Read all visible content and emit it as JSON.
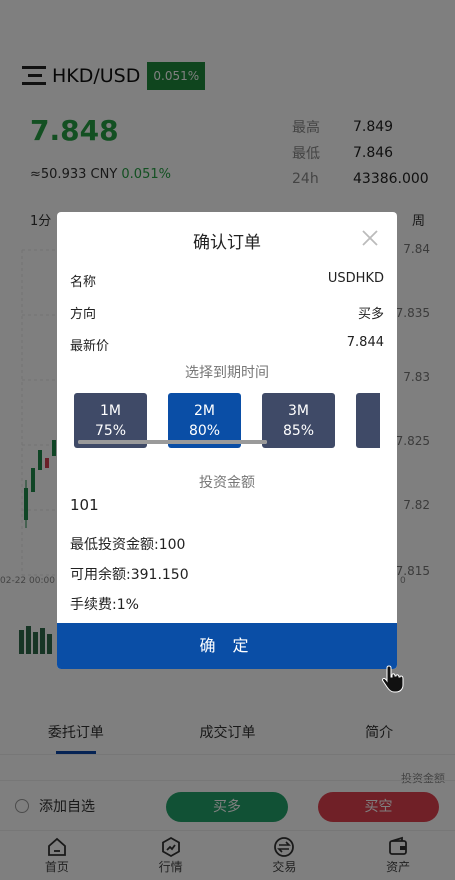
{
  "header": {
    "symbol": "HKD/USD",
    "change_badge": "0.051%"
  },
  "price": "7.848",
  "cny": {
    "value": "≈50.933 CNY",
    "change": "0.051%"
  },
  "stats": [
    {
      "label": "最高",
      "value": "7.849"
    },
    {
      "label": "最低",
      "value": "7.846"
    },
    {
      "label": "24h",
      "value": "43386.000"
    }
  ],
  "periods": {
    "first": "1分",
    "last": "周"
  },
  "chart": {
    "y_ticks": [
      "7.84",
      "7.835",
      "7.83",
      "7.825",
      "7.82",
      "7.815"
    ],
    "x_tick": "02-22 00:00",
    "x_tick_right": "0"
  },
  "modal": {
    "title": "确认订单",
    "rows": [
      {
        "label": "名称",
        "value": "USDHKD"
      },
      {
        "label": "方向",
        "value": "买多"
      },
      {
        "label": "最新价",
        "value": "7.844"
      }
    ],
    "expiry_label": "选择到期时间",
    "options": [
      {
        "period": "1M",
        "rate": "75%",
        "selected": false
      },
      {
        "period": "2M",
        "rate": "80%",
        "selected": true
      },
      {
        "period": "3M",
        "rate": "85%",
        "selected": false
      }
    ],
    "amount_label": "投资金额",
    "amount_value": "101",
    "min_amount": "最低投资金额:100",
    "balance": "可用余额:391.150",
    "fee": "手续费:1%",
    "confirm": "确 定"
  },
  "tabs": [
    {
      "label": "委托订单",
      "active": true
    },
    {
      "label": "成交订单",
      "active": false
    },
    {
      "label": "简介",
      "active": false
    }
  ],
  "faint_header": "投资金额",
  "actions": {
    "add_favorite": "添加自选",
    "buy": "买多",
    "sell": "买空"
  },
  "nav": [
    {
      "label": "首页",
      "icon": "home-icon"
    },
    {
      "label": "行情",
      "icon": "market-icon"
    },
    {
      "label": "交易",
      "icon": "exchange-icon"
    },
    {
      "label": "资产",
      "icon": "wallet-icon"
    }
  ],
  "colors": {
    "green": "#27a145",
    "accent_blue": "#0a4ea6",
    "option_gray": "#3f4a67",
    "sell_red": "#e1404f",
    "buy_green": "#23a36a"
  }
}
